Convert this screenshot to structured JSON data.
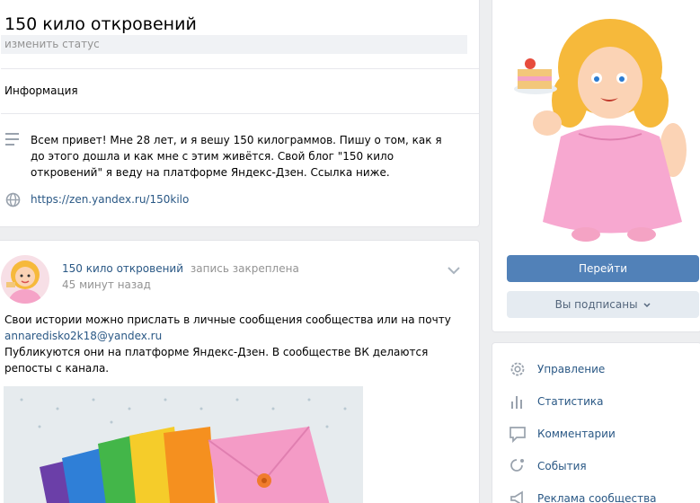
{
  "profile": {
    "name": "150 кило откровений",
    "status_placeholder": "изменить статус",
    "info_title": "Информация",
    "about": "Всем привет! Мне 28 лет, и я вешу 150 килограммов. Пишу о том, как я до этого дошла и как мне с этим живётся. Свой блог \"150 кило откровений\" я веду на платформе Яндекс-Дзен. Ссылка ниже.",
    "link": "https://zen.yandex.ru/150kilo"
  },
  "post": {
    "author": "150 кило откровений",
    "action": "запись закреплена",
    "time": "45 минут назад",
    "text_line1": "Свои истории можно прислать в личные сообщения сообщества или на почту",
    "email": "annaredisko2k18@yandex.ru",
    "text_line2": "Публикуются они на платформе Яндекс-Дзен. В сообществе ВК делаются репосты с канала."
  },
  "side": {
    "go_button": "Перейти",
    "subscribed_button": "Вы подписаны"
  },
  "menu": [
    {
      "label": "Управление",
      "icon": "gear-icon"
    },
    {
      "label": "Статистика",
      "icon": "stats-icon"
    },
    {
      "label": "Комментарии",
      "icon": "comments-icon"
    },
    {
      "label": "События",
      "icon": "events-icon"
    },
    {
      "label": "Реклама сообщества",
      "icon": "megaphone-icon"
    }
  ],
  "colors": {
    "accent": "#5181b8",
    "link": "#2a5885",
    "background": "#edeef0"
  }
}
